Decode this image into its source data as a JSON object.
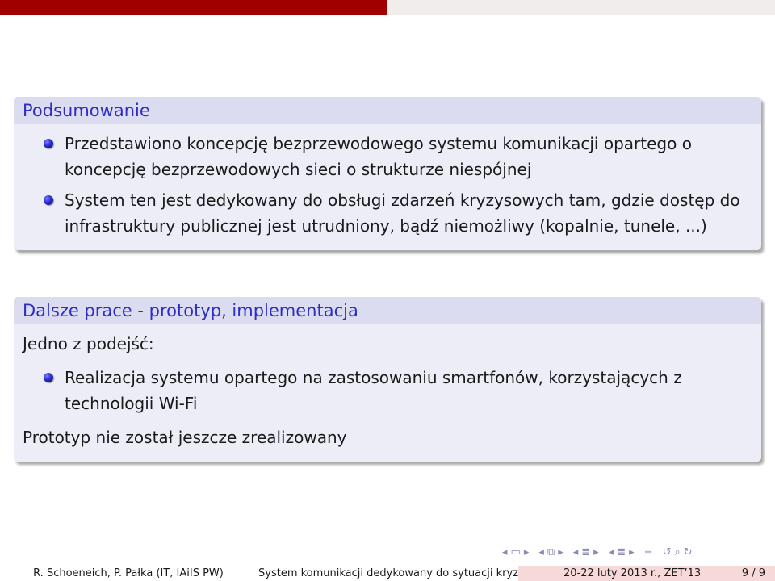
{
  "summary": {
    "title": "Podsumowanie",
    "items": [
      "Przedstawiono koncepcję bezprzewodowego systemu komunikacji opartego o koncepcję bezprzewodowych sieci o strukturze niespójnej",
      "System ten jest dedykowany do obsługi zdarzeń kryzysowych tam, gdzie dostęp do infrastruktury publicznej jest utrudniony, bądź niemożliwy (kopalnie, tunele, ...)"
    ]
  },
  "future": {
    "title": "Dalsze prace - prototyp, implementacja",
    "intro": "Jedno z podejść:",
    "items": [
      "Realizacja systemu opartego na zastosowaniu smartfonów, korzystających z technologii Wi-Fi"
    ],
    "outro": "Prototyp nie został jeszcze zrealizowany"
  },
  "footer": {
    "authors": "R. Schoeneich, P. Pałka  (IT, IAiIS PW)",
    "talk_title": "System komunikacji dedykowany do sytuacji kryzysowy",
    "date": "20-22 luty 2013 r., ZET’13",
    "page": "9 / 9"
  },
  "nav_icons": [
    "left-arrow-icon",
    "frame-icon",
    "right-arrow-icon",
    "subsection-icon",
    "section-icon",
    "align-icon",
    "search-back-icon"
  ],
  "colors": {
    "header_red": "#a00000",
    "block_title": "#2e2ec2",
    "block_bg": "#ecedf6"
  }
}
